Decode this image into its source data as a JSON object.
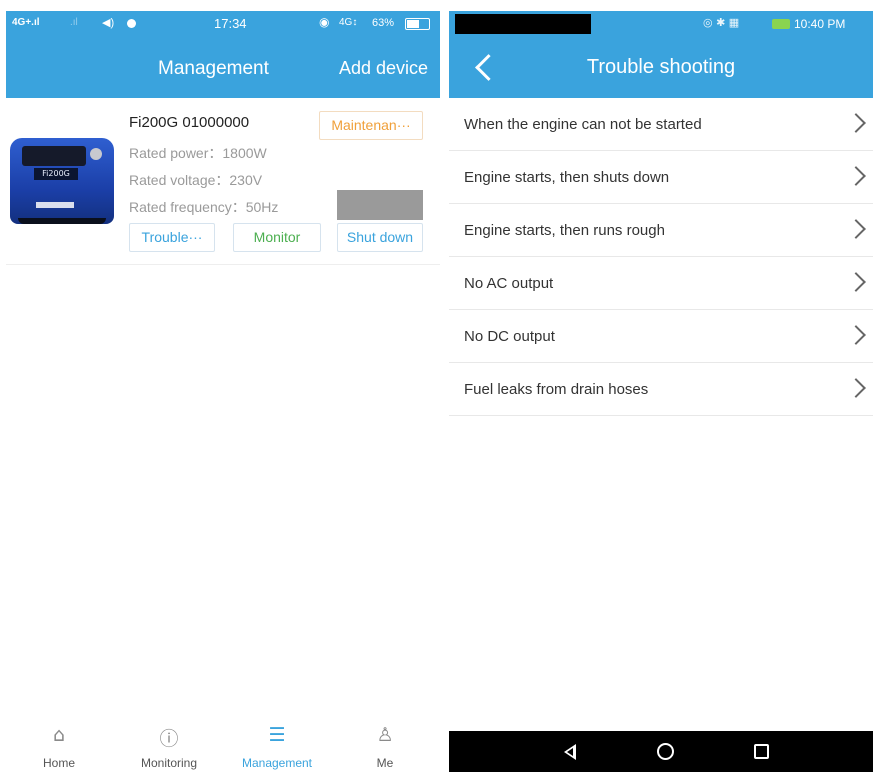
{
  "left_screen": {
    "status_bar": {
      "signal": "4G+.ıl",
      "signal2": ".ıl",
      "speaker": "◀)",
      "time": "17:34",
      "alarm": "◉",
      "network": "4G↕",
      "battery": "63%",
      "battery_level": 0.63
    },
    "header": {
      "title": "Management",
      "add_device": "Add device"
    },
    "device": {
      "name": "Fi200G 01000000",
      "image_label": "Fi200G",
      "rated_power": "Rated power：1800W",
      "rated_voltage": "Rated voltage：230V",
      "rated_frequency": "Rated frequency：50Hz",
      "maintenance_button": "Maintenan···",
      "trouble_button": "Trouble···",
      "monitor_button": "Monitor",
      "shutdown_button": "Shut down"
    },
    "tabbar": [
      {
        "label": "Home",
        "icon": "home-icon",
        "glyph": "⌂"
      },
      {
        "label": "Monitoring",
        "icon": "info-circle-icon",
        "glyph": "ⓘ"
      },
      {
        "label": "Management",
        "icon": "sliders-icon",
        "glyph": "☰"
      },
      {
        "label": "Me",
        "icon": "person-icon",
        "glyph": "♙"
      }
    ],
    "active_tab": "Management",
    "colors": {
      "primary": "#3aa3dd",
      "maintenance": "#f0a03a",
      "monitor": "#4caf50"
    }
  },
  "right_screen": {
    "status_bar": {
      "icons": "◎ ✱ ▦",
      "time": "10:40 PM"
    },
    "header": {
      "title": "Trouble shooting"
    },
    "items": [
      {
        "label": "When the engine can not be started"
      },
      {
        "label": "Engine starts, then shuts down"
      },
      {
        "label": "Engine starts, then runs rough"
      },
      {
        "label": "No AC output"
      },
      {
        "label": "No DC output"
      },
      {
        "label": "Fuel leaks from drain hoses"
      }
    ]
  }
}
